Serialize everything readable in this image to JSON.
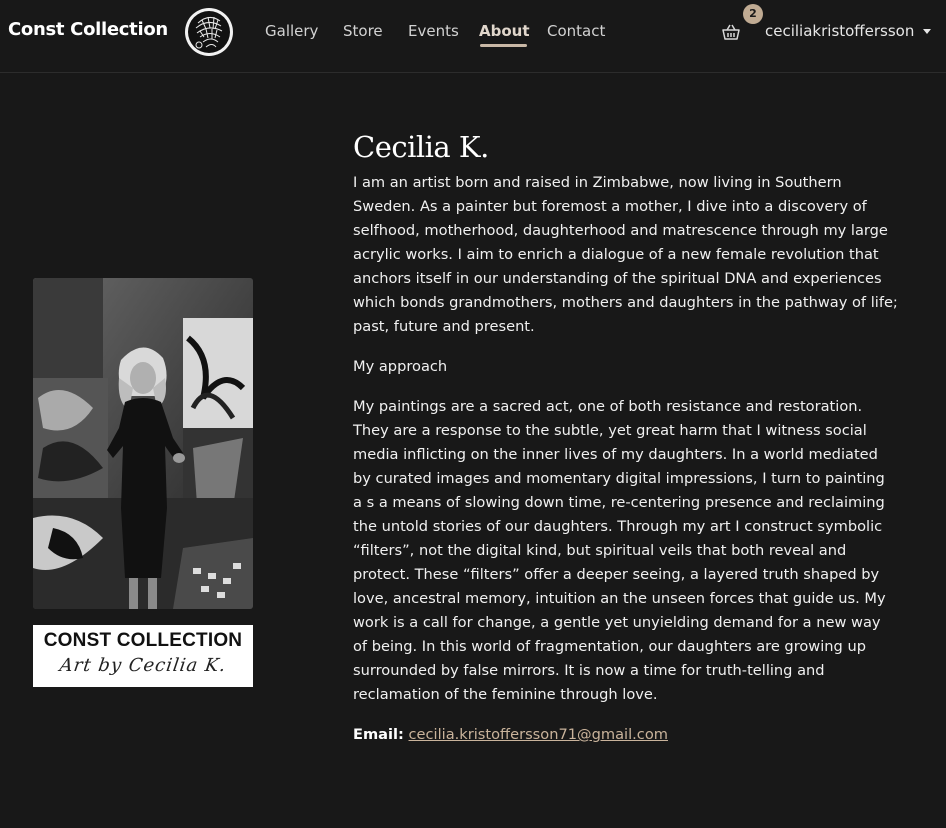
{
  "nav": {
    "brand": "Const Collection",
    "links": [
      {
        "label": "Gallery"
      },
      {
        "label": "Store"
      },
      {
        "label": "Events"
      },
      {
        "label": "About"
      },
      {
        "label": "Contact"
      }
    ],
    "active_link": "About",
    "cart_count": "2",
    "username": "ceciliakristoffersson",
    "cart_icon": "basket-icon",
    "caret_icon": "caret-down-icon"
  },
  "sidebar": {
    "portrait_alt": "portrait-photo",
    "logo_card_title": "CONST COLLECTION",
    "logo_card_signature": "Art by Cecilia K."
  },
  "about": {
    "name": "Cecilia K.",
    "paragraphs": [
      "I am an artist born and raised in Zimbabwe, now living in Southern Sweden. As a painter but foremost a mother, I dive into a discovery of selfhood, motherhood, daughterhood and matrescence through my large acrylic works. I aim to enrich a dialogue of a new female revolution that anchors itself in our understanding of the spiritual DNA and experiences which bonds grandmothers, mothers and daughters in the pathway of life; past, future and present.",
      "My approach",
      "My paintings are a sacred act, one of both resistance and restoration. They are a response to the subtle, yet great harm that I witness social media inflicting on the inner lives of my daughters. In a world mediated by curated images and momentary digital impressions, I turn to painting a s a means of slowing down time, re-centering presence and reclaiming the untold stories of our daughters. Through my art I construct symbolic “filters”, not the digital kind, but spiritual veils that both reveal and protect. These “filters” offer a deeper seeing, a layered truth shaped by love, ancestral memory, intuition an the unseen forces that guide us. My work is a call for change, a gentle yet unyielding demand for a new way of being. In this world of fragmentation, our daughters are growing up surrounded by false mirrors. It is now a time for truth-telling and reclamation of the feminine through love."
    ],
    "email_label": "Email:",
    "email": "cecilia.kristoffersson71@gmail.com"
  },
  "colors": {
    "background": "#181818",
    "accent": "#c9b39b",
    "badge": "#c0ab93"
  }
}
